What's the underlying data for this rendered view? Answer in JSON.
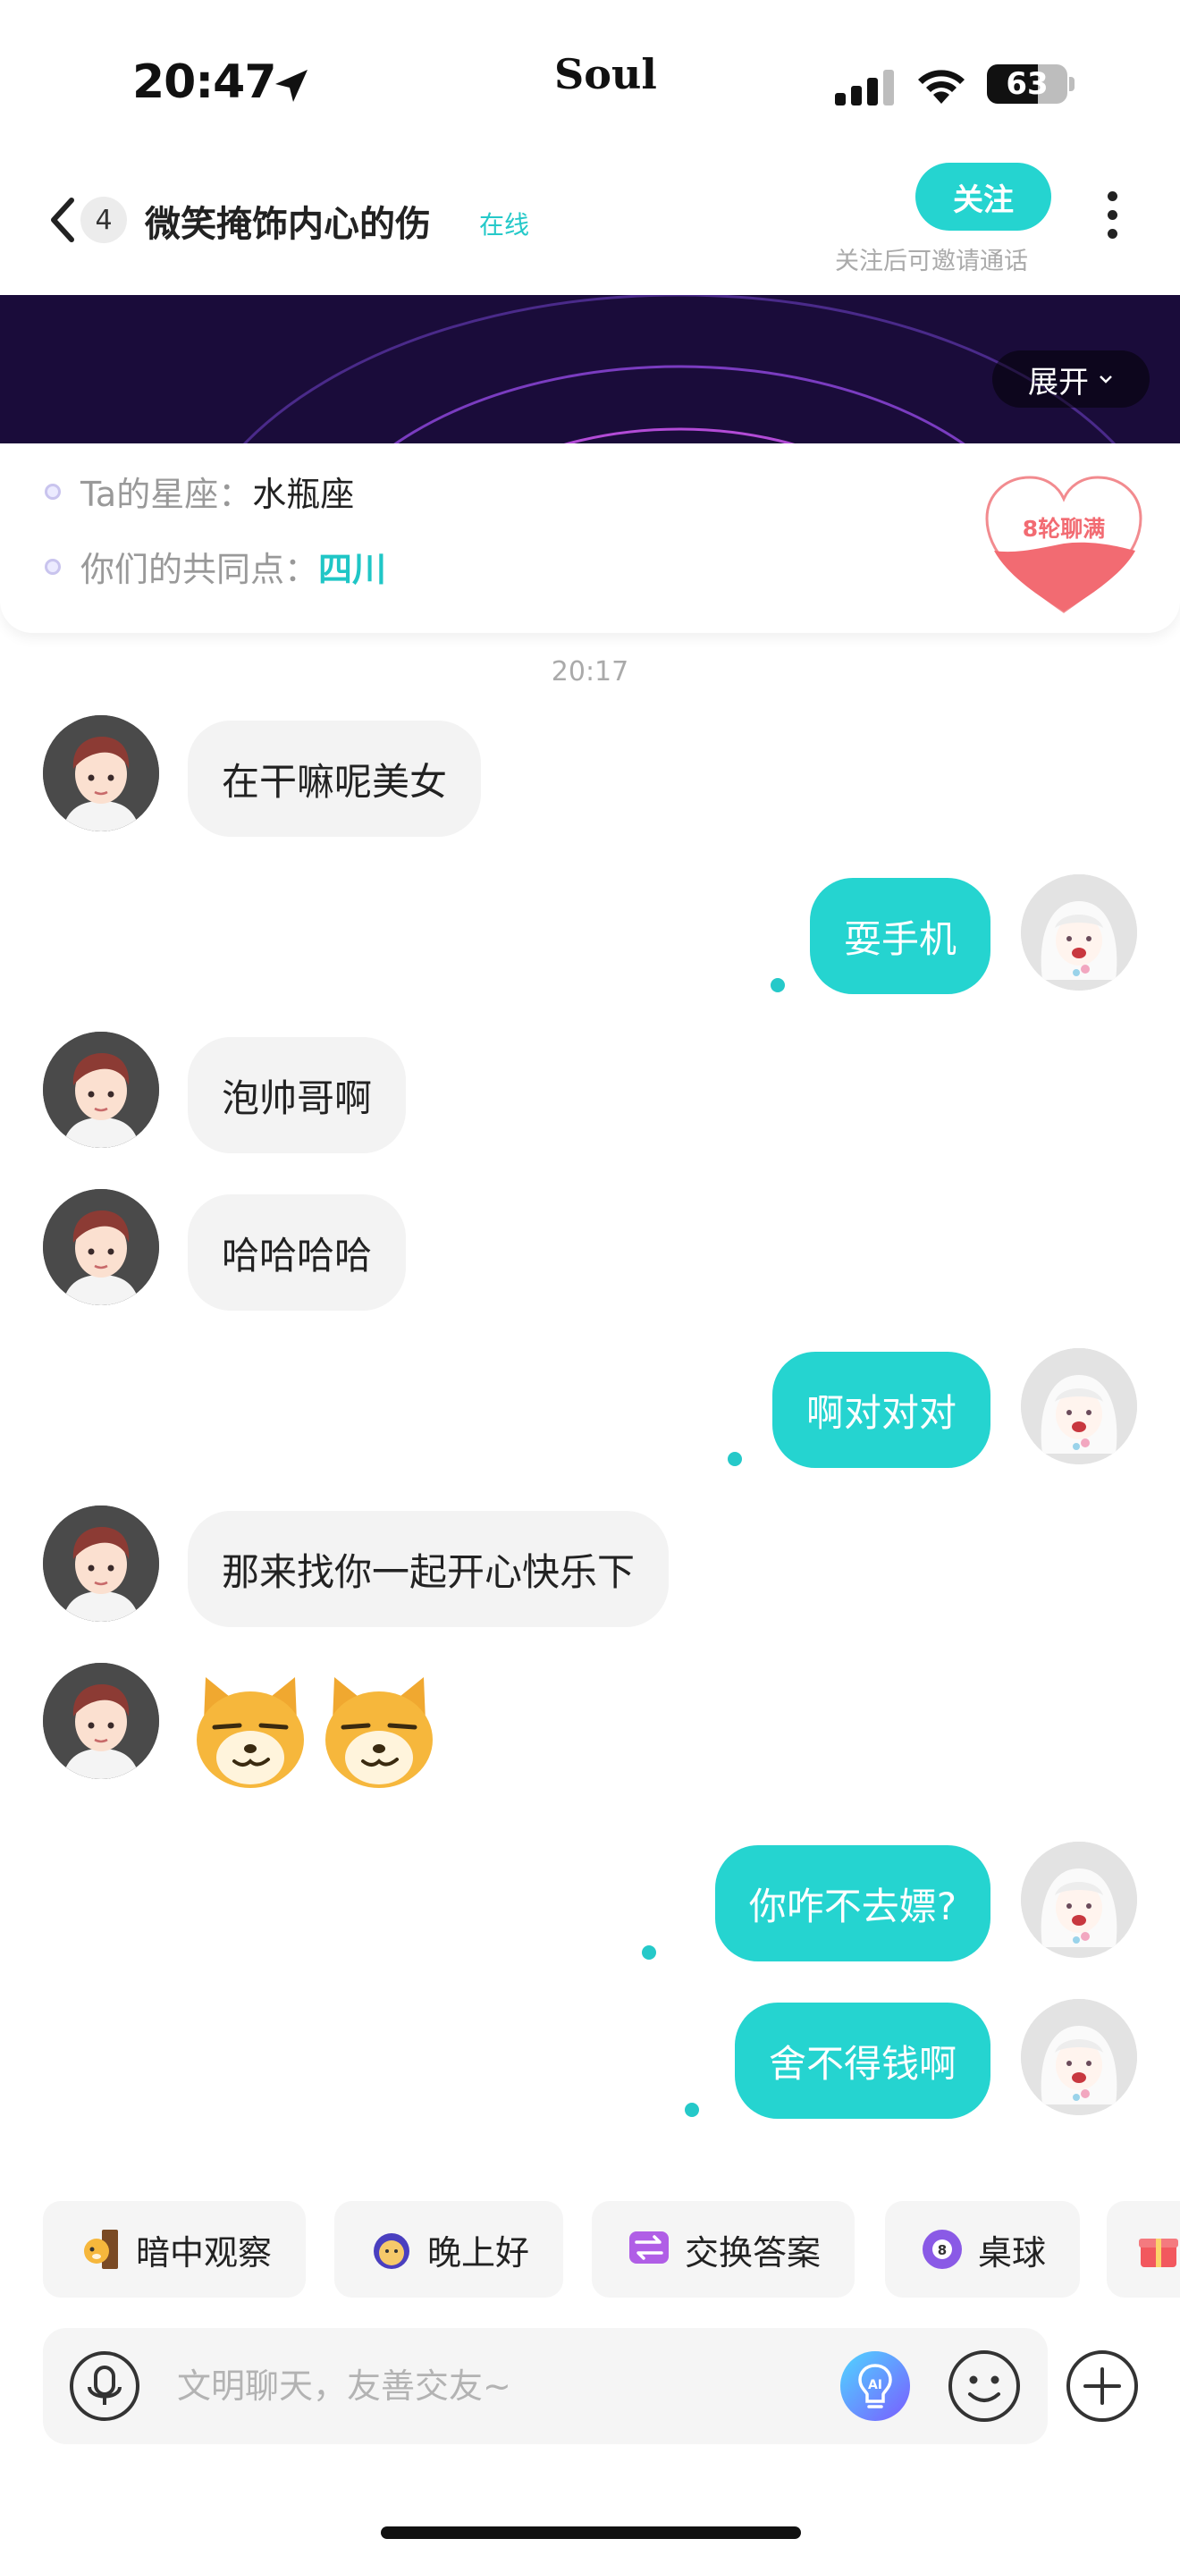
{
  "status_bar": {
    "time": "20:47",
    "app_logo": "Soul",
    "battery": "63",
    "battery_level": 0.63,
    "icons": [
      "location-arrow-icon",
      "signal-icon",
      "wifi-icon",
      "battery-icon"
    ]
  },
  "header": {
    "unread_count": "4",
    "title": "微笑掩饰内心的伤",
    "online_status": "在线",
    "follow_label": "关注",
    "follow_hint": "关注后可邀请通话",
    "icons": [
      "back-icon",
      "more-icon"
    ]
  },
  "banner": {
    "expand_label": "展开"
  },
  "info_card": {
    "zodiac_label": "Ta的星座：",
    "zodiac_value": "水瓶座",
    "common_label": "你们的共同点：",
    "common_value": "四川",
    "heart_badge": "8轮聊满"
  },
  "chat": {
    "timestamp": "20:17",
    "messages": [
      {
        "side": "left",
        "text": "在干嘛呢美女"
      },
      {
        "side": "right",
        "text": "耍手机"
      },
      {
        "side": "left",
        "text": "泡帅哥啊"
      },
      {
        "side": "left",
        "text": "哈哈哈哈"
      },
      {
        "side": "right",
        "text": "啊对对对"
      },
      {
        "side": "left",
        "text": "那来找你一起开心快乐下"
      },
      {
        "side": "left",
        "sticker": "dog-smirk-emoji",
        "count": 2
      },
      {
        "side": "right",
        "text": "你咋不去嫖?"
      },
      {
        "side": "right",
        "text": "舍不得钱啊"
      }
    ]
  },
  "quick_chips": [
    {
      "label": "暗中观察",
      "icon": "peek-dog-icon"
    },
    {
      "label": "晚上好",
      "icon": "moon-icon"
    },
    {
      "label": "交换答案",
      "icon": "swap-icon"
    },
    {
      "label": "桌球",
      "icon": "billiard-ball-icon"
    },
    {
      "label": "",
      "icon": "gift-icon"
    }
  ],
  "input_bar": {
    "placeholder": "文明聊天，友善交友~",
    "icons": [
      "voice-icon",
      "ai-icon",
      "emoji-icon",
      "plus-icon"
    ]
  },
  "colors": {
    "accent": "#25d4d0",
    "accent_text": "#1fc6c6",
    "banner_bg": "#1a0c3a",
    "bubble_left": "#f3f3f3",
    "heart": "#f26b72"
  }
}
